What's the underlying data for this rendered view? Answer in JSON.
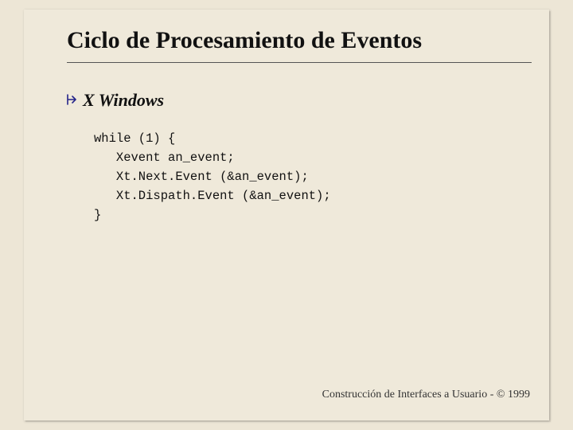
{
  "title": "Ciclo de Procesamiento de Eventos",
  "subhead": "X Windows",
  "code": "while (1) {\n   Xevent an_event;\n   Xt.Next.Event (&an_event);\n   Xt.Dispath.Event (&an_event);\n}",
  "footer": "Construcción de Interfaces a Usuario - © 1999"
}
